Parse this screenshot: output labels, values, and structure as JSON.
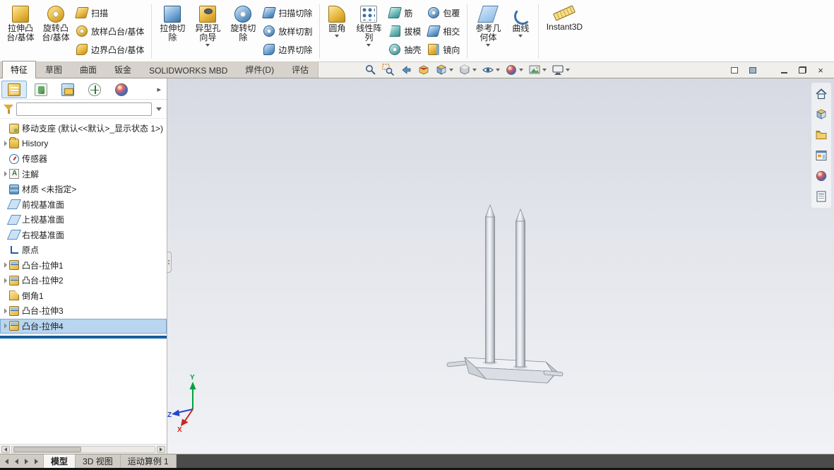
{
  "ribbon": {
    "big": [
      {
        "l1": "拉伸凸",
        "l2": "台/基体"
      },
      {
        "l1": "旋转凸",
        "l2": "台/基体"
      },
      {
        "l1": "拉伸切",
        "l2": "除"
      },
      {
        "l1": "异型孔",
        "l2": "向导"
      },
      {
        "l1": "旋转切",
        "l2": "除"
      },
      {
        "l1": "圆角",
        "l2": ""
      },
      {
        "l1": "线性阵",
        "l2": "列"
      },
      {
        "l1": "参考几",
        "l2": "何体"
      },
      {
        "l1": "曲线",
        "l2": ""
      }
    ],
    "small": [
      "扫描",
      "放样凸台/基体",
      "边界凸台/基体",
      "扫描切除",
      "放样切割",
      "边界切除",
      "筋",
      "拔模",
      "抽壳",
      "包覆",
      "相交",
      "镜向"
    ],
    "instant3d": "Instant3D"
  },
  "tabs": {
    "items": [
      "特征",
      "草图",
      "曲面",
      "钣金",
      "SOLIDWORKS MBD",
      "焊件(D)",
      "评估"
    ],
    "active": "特征"
  },
  "view_toolbar_icons": [
    "zoom-to-fit",
    "zoom-to-area",
    "previous-view",
    "section-view",
    "view-orientation",
    "display-style",
    "hide-show-items",
    "edit-appearance",
    "apply-scene",
    "view-settings"
  ],
  "window_control_icons": [
    "pane-left",
    "pane-right",
    "minimize",
    "restore",
    "close"
  ],
  "feature_tree": {
    "filter_value": "",
    "root_label": "移动支座 (默认<<默认>_显示状态 1>)",
    "items": [
      {
        "label": "History"
      },
      {
        "label": "传感器"
      },
      {
        "label": "注解"
      },
      {
        "label": "材质 <未指定>"
      },
      {
        "label": "前视基准面"
      },
      {
        "label": "上视基准面"
      },
      {
        "label": "右视基准面"
      },
      {
        "label": "原点"
      },
      {
        "label": "凸台-拉伸1"
      },
      {
        "label": "凸台-拉伸2"
      },
      {
        "label": "倒角1"
      },
      {
        "label": "凸台-拉伸3"
      },
      {
        "label": "凸台-拉伸4"
      }
    ]
  },
  "task_pane_icons": [
    "home",
    "design-library",
    "file-explorer",
    "view-palette",
    "appearances",
    "custom-properties"
  ],
  "bottom_tabs": {
    "items": [
      "模型",
      "3D 视图",
      "运动算例 1"
    ],
    "active": "模型"
  },
  "triad": {
    "x": "X",
    "y": "Y",
    "z": "Z"
  },
  "colors": {
    "accent": "#1464ac",
    "selection": "#b8d6f0",
    "viewport_top": "#d7dae3",
    "viewport_bottom": "#f1f2f5",
    "icon_gold": "#e8b93f",
    "icon_blue": "#76a9d8"
  }
}
